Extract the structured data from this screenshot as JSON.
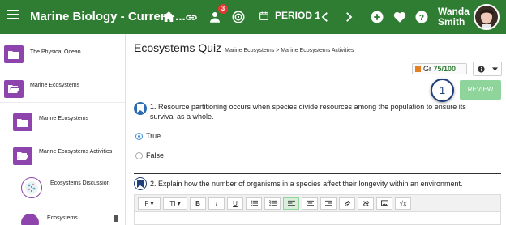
{
  "header": {
    "title": "Marine Biology - Current ...",
    "notification_count": "3",
    "period_label": "PERIOD 1",
    "user_first": "Wanda",
    "user_last": "Smith",
    "icons": [
      "home-icon",
      "link-icon",
      "people-icon",
      "target-icon",
      "calendar-icon",
      "chevron-left-icon",
      "chevron-right-icon",
      "add-circle-icon",
      "heart-icon",
      "help-icon"
    ],
    "bar_color": "#2e7d32"
  },
  "sidebar": {
    "items": [
      {
        "label": "The Physical Ocean"
      },
      {
        "label": "Marine Ecosystems"
      },
      {
        "label": "Marine Ecosystems"
      },
      {
        "label": "Marine Ecosystems Activities"
      },
      {
        "label": "Ecosystems Discussion"
      },
      {
        "label": "Ecosystems"
      }
    ],
    "tile_color": "#8e44ad"
  },
  "quiz": {
    "title": "Ecosystems Quiz",
    "breadcrumb": "Marine Ecosystems > Marine Ecosystems Activities",
    "grade_prefix": "Gr",
    "grade_value": "75/100",
    "step_number": "1",
    "review_label": "REVIEW",
    "q1_text": "1. Resource partitioning occurs when species divide resources among the population to ensure its survival as a whole.",
    "q1_options": [
      "True .",
      "False"
    ],
    "q1_selected": "True .",
    "q2_text": "2. Explain how the number of organisms in a species affect their longevity within an environment."
  },
  "editor_toolbar": {
    "buttons": [
      "F",
      "TI",
      "B",
      "I",
      "U",
      "bulleted-list-icon",
      "numbered-list-icon",
      "align-left-icon",
      "align-center-icon",
      "align-right-icon",
      "link-icon",
      "unlink-icon",
      "image-icon",
      "formula-icon"
    ],
    "formula_label": "√x"
  }
}
